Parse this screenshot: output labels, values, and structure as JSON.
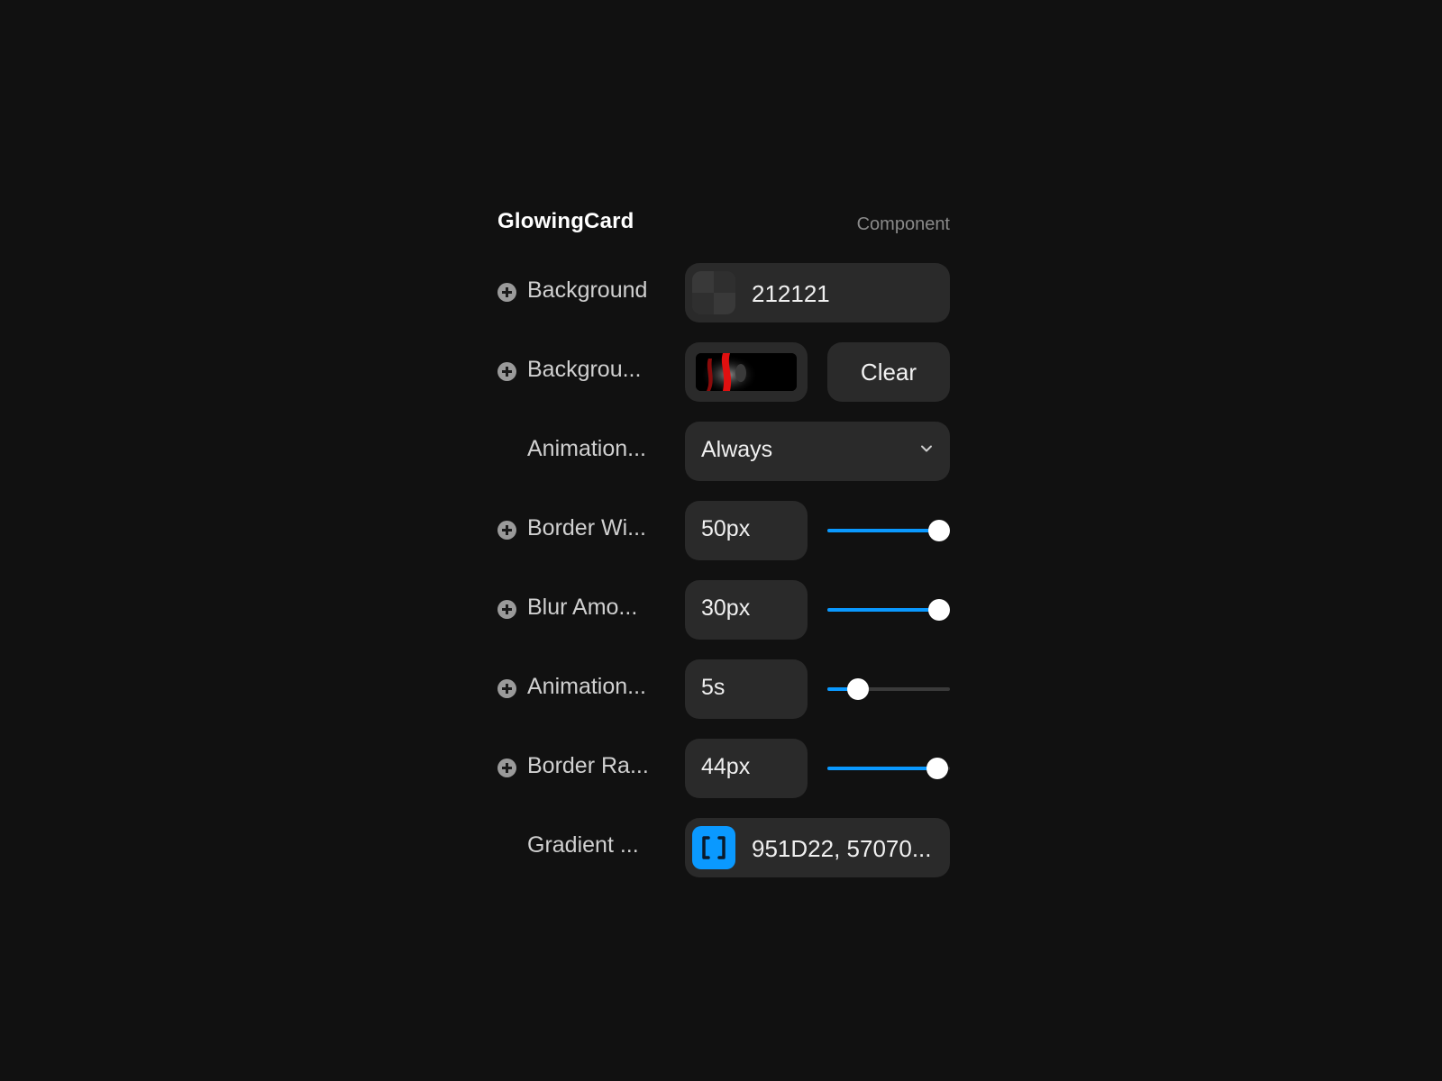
{
  "header": {
    "title": "GlowingCard",
    "subtitle": "Component"
  },
  "rows": {
    "background": {
      "label": "Background",
      "value": "212121"
    },
    "background_image": {
      "label": "Backgrou...",
      "clear_label": "Clear"
    },
    "animation_mode": {
      "label": "Animation...",
      "value": "Always"
    },
    "border_width": {
      "label": "Border Wi...",
      "value": "50px",
      "slider_fraction": 1.0
    },
    "blur_amount": {
      "label": "Blur Amo...",
      "value": "30px",
      "slider_fraction": 1.0
    },
    "animation_duration": {
      "label": "Animation...",
      "value": "5s",
      "slider_fraction": 0.25
    },
    "border_radius": {
      "label": "Border Ra...",
      "value": "44px",
      "slider_fraction": 0.9
    },
    "gradient": {
      "label": "Gradient ...",
      "value": "951D22, 57070..."
    }
  },
  "colors": {
    "background": "#111111",
    "field": "#2a2a2a",
    "accent": "#0a99ff",
    "text": "#f0f0f0",
    "muted": "#8a8a8a"
  },
  "icons": {
    "add": "plus-circle-icon",
    "dropdown": "chevron-down-icon",
    "array": "bracket-icon"
  }
}
